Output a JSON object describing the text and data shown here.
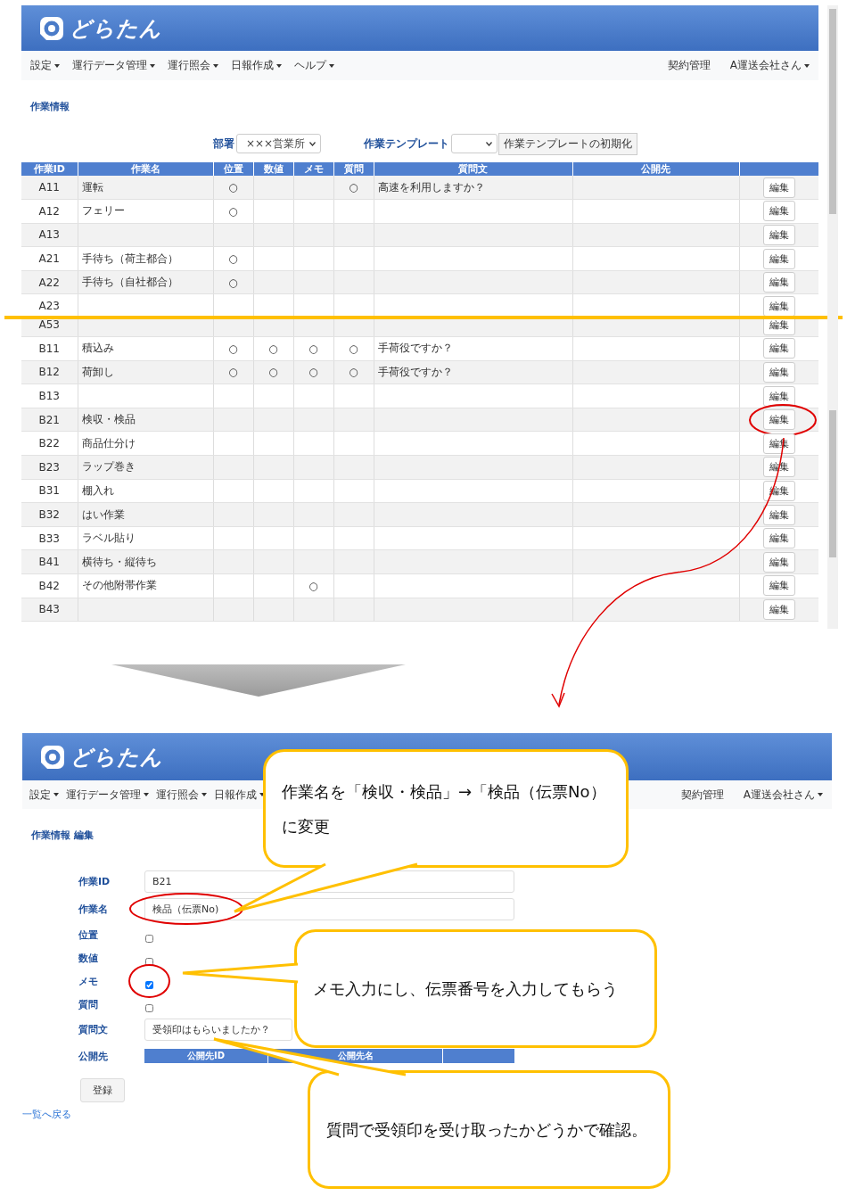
{
  "list_screen": {
    "logo": "どらたん",
    "nav": {
      "left": [
        {
          "label": "設定",
          "dropdown": true
        },
        {
          "label": "運行データ管理",
          "dropdown": true
        },
        {
          "label": "運行照会",
          "dropdown": true
        },
        {
          "label": "日報作成",
          "dropdown": true
        },
        {
          "label": "ヘルプ",
          "dropdown": true
        }
      ],
      "right": [
        {
          "label": "契約管理",
          "dropdown": false
        },
        {
          "label": "A運送会社さん",
          "dropdown": true
        }
      ]
    },
    "title": "作業情報",
    "filters": {
      "department": {
        "label": "部署",
        "value": "×××営業所"
      },
      "template": {
        "label": "作業テンプレート"
      },
      "reset_button": "作業テンプレートの初期化"
    },
    "table": {
      "columns": [
        "作業ID",
        "作業名",
        "位置",
        "数値",
        "メモ",
        "質問",
        "質問文",
        "公開先"
      ],
      "rows_before_cut": [
        {
          "id": "A11",
          "name": "運転",
          "position": "○",
          "question": "○",
          "question_text": "高速を利用しますか？",
          "button": "編集",
          "circled": false
        },
        {
          "id": "A12",
          "name": "フェリー",
          "position": "○",
          "button": "編集",
          "circled": false
        },
        {
          "id": "A13",
          "button": "編集",
          "circled": false
        },
        {
          "id": "A21",
          "name": "手待ち（荷主都合）",
          "position": "○",
          "button": "編集",
          "circled": false
        },
        {
          "id": "A22",
          "name": "手待ち（自社都合）",
          "position": "○",
          "button": "編集",
          "circled": false
        },
        {
          "id": "A23",
          "button": "編集",
          "circled": false
        }
      ],
      "rows_after_cut": [
        {
          "id": "A53",
          "button": "編集",
          "circled": false
        },
        {
          "id": "B11",
          "name": "積込み",
          "position": "○",
          "number": "○",
          "memo": "○",
          "question": "○",
          "question_text": "手荷役ですか？",
          "button": "編集",
          "circled": false
        },
        {
          "id": "B12",
          "name": "荷卸し",
          "position": "○",
          "number": "○",
          "memo": "○",
          "question": "○",
          "question_text": "手荷役ですか？",
          "button": "編集",
          "circled": false
        },
        {
          "id": "B13",
          "button": "編集",
          "circled": false
        },
        {
          "id": "B21",
          "name": "検収・検品",
          "button": "編集",
          "circled": true
        },
        {
          "id": "B22",
          "name": "商品仕分け",
          "button": "編集",
          "circled": false
        },
        {
          "id": "B23",
          "name": "ラップ巻き",
          "button": "編集",
          "circled": false
        },
        {
          "id": "B31",
          "name": "棚入れ",
          "button": "編集",
          "circled": false
        },
        {
          "id": "B32",
          "name": "はい作業",
          "button": "編集",
          "circled": false
        },
        {
          "id": "B33",
          "name": "ラベル貼り",
          "button": "編集",
          "circled": false
        },
        {
          "id": "B41",
          "name": "横待ち・縦待ち",
          "button": "編集",
          "circled": false
        },
        {
          "id": "B42",
          "name": "その他附帯作業",
          "memo": "○",
          "button": "編集",
          "circled": false
        },
        {
          "id": "B43",
          "button": "編集",
          "circled": false
        }
      ]
    }
  },
  "edit_screen": {
    "logo": "どらたん",
    "nav": {
      "left": [
        {
          "label": "設定",
          "dropdown": true
        },
        {
          "label": "運行データ管理",
          "dropdown": true
        },
        {
          "label": "運行照会",
          "dropdown": true
        },
        {
          "label": "日報作成",
          "dropdown": true
        }
      ],
      "right": [
        {
          "label": "契約管理",
          "dropdown": false
        },
        {
          "label": "A運送会社さん",
          "dropdown": true
        }
      ]
    },
    "title": "作業情報 編集",
    "fields": [
      {
        "kind": "text",
        "label": "作業ID",
        "value": "B21",
        "circled": false
      },
      {
        "kind": "text",
        "label": "作業名",
        "value": "検品（伝票No)",
        "circled": true
      },
      {
        "kind": "checkbox",
        "label": "位置",
        "checked": false,
        "circled": false
      },
      {
        "kind": "checkbox",
        "label": "数値",
        "checked": false,
        "circled": false
      },
      {
        "kind": "checkbox",
        "label": "メモ",
        "checked": true,
        "circled": true
      },
      {
        "kind": "checkbox",
        "label": "質問",
        "checked": false,
        "circled": false
      },
      {
        "kind": "text",
        "label": "質問文",
        "value": "受領印はもらいましたか？",
        "circled": false
      },
      {
        "kind": "table",
        "label": "公開先",
        "columns": [
          "公開先ID",
          "公開先名"
        ],
        "circled": false
      }
    ],
    "submit_button": "登録",
    "back_link": "一覧へ戻る"
  },
  "callouts": [
    {
      "text": "作業名を「検収・検品」→「検品（伝票No）に変更"
    },
    {
      "text": "メモ入力にし、伝票番号を入力してもらう"
    },
    {
      "text": "質問で受領印を受け取ったかどうかで確認。"
    }
  ]
}
